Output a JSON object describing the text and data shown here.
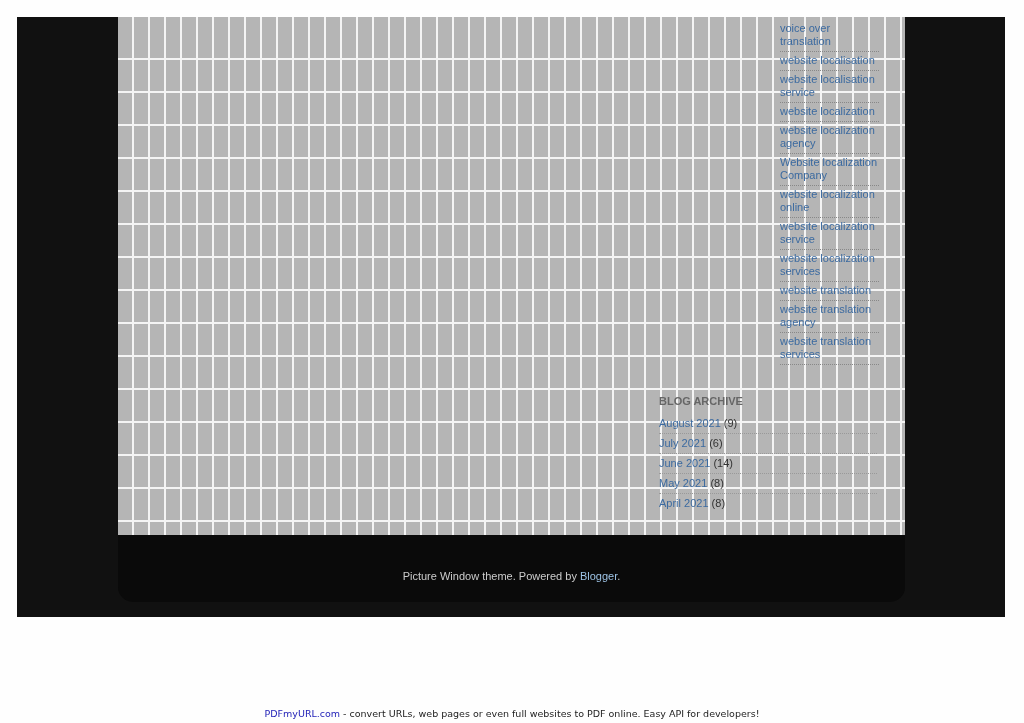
{
  "labels": [
    {
      "text": "voice over translation"
    },
    {
      "text": "website localisation"
    },
    {
      "text": "website localisation service"
    },
    {
      "text": "website localization"
    },
    {
      "text": "website localization agency"
    },
    {
      "text": "Website localization Company"
    },
    {
      "text": "website localization online"
    },
    {
      "text": "website localization service"
    },
    {
      "text": "website localization services"
    },
    {
      "text": "website translation"
    },
    {
      "text": "website translation agency"
    },
    {
      "text": "website translation services"
    }
  ],
  "blog_archive": {
    "title": "BLOG ARCHIVE",
    "items": [
      {
        "month": "August 2021",
        "count": "(9)"
      },
      {
        "month": "July 2021",
        "count": "(6)"
      },
      {
        "month": "June 2021",
        "count": "(14)"
      },
      {
        "month": "May 2021",
        "count": "(8)"
      },
      {
        "month": "April 2021",
        "count": "(8)"
      }
    ]
  },
  "footer": {
    "text": "Picture Window theme. Powered by",
    "link": "Blogger",
    "suffix": "."
  },
  "pdf_banner": {
    "link": "PDFmyURL.com",
    "text": "- convert URLs, web pages or even full websites to PDF online. Easy API for developers!"
  }
}
